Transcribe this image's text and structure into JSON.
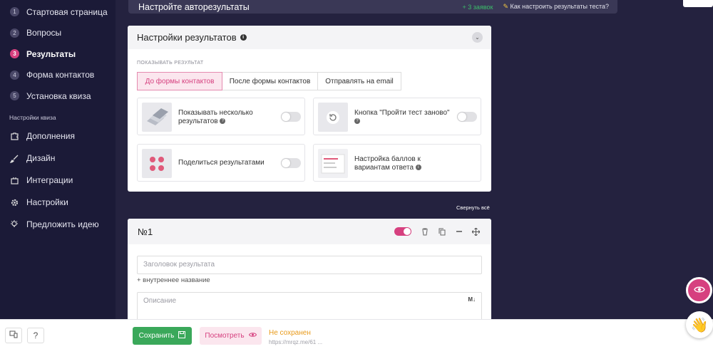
{
  "sidebar": {
    "steps": [
      {
        "num": "1",
        "label": "Стартовая страница"
      },
      {
        "num": "2",
        "label": "Вопросы"
      },
      {
        "num": "3",
        "label": "Результаты"
      },
      {
        "num": "4",
        "label": "Форма контактов"
      },
      {
        "num": "5",
        "label": "Установка квиза"
      }
    ],
    "section_title": "Настройки квиза",
    "menu": [
      {
        "icon": "puzzle-icon",
        "label": "Дополнения"
      },
      {
        "icon": "brush-icon",
        "label": "Дизайн"
      },
      {
        "icon": "plug-icon",
        "label": "Интеграции"
      },
      {
        "icon": "gear-icon",
        "label": "Настройки"
      },
      {
        "icon": "lightbulb-icon",
        "label": "Предложить идею"
      }
    ]
  },
  "topbar": {
    "title": "Настройте авторезультаты",
    "right_green": "+ 3 заявок",
    "help_link": "Как настроить результаты теста?"
  },
  "settings": {
    "title": "Настройки результатов",
    "show_label": "ПОКАЗЫВАТЬ РЕЗУЛЬТАТ",
    "tabs": [
      "До формы контактов",
      "После формы контактов",
      "Отправлять на email"
    ],
    "options": [
      {
        "label": "Показывать несколько результатов",
        "enabled": false
      },
      {
        "label": "Кнопка \"Пройти тест заново\"",
        "enabled": false
      },
      {
        "label": "Поделиться результатами",
        "enabled": false
      },
      {
        "label": "Настройка баллов к вариантам ответа"
      }
    ]
  },
  "collapse_all": "Свернуть всё",
  "result": {
    "title": "№1",
    "title_placeholder": "Заголовок результата",
    "add_internal_name": "+ внутреннее название",
    "description_placeholder": "Описание"
  },
  "footer": {
    "help": "?",
    "save": "Сохранить",
    "preview": "Посмотреть",
    "status": "Не сохранен",
    "url": "https://mrqz.me/61 ..."
  },
  "colors": {
    "accent": "#d6407f",
    "save": "#3aa85a",
    "sidebar_bg": "#1b1a37",
    "status": "#e89a1a"
  }
}
